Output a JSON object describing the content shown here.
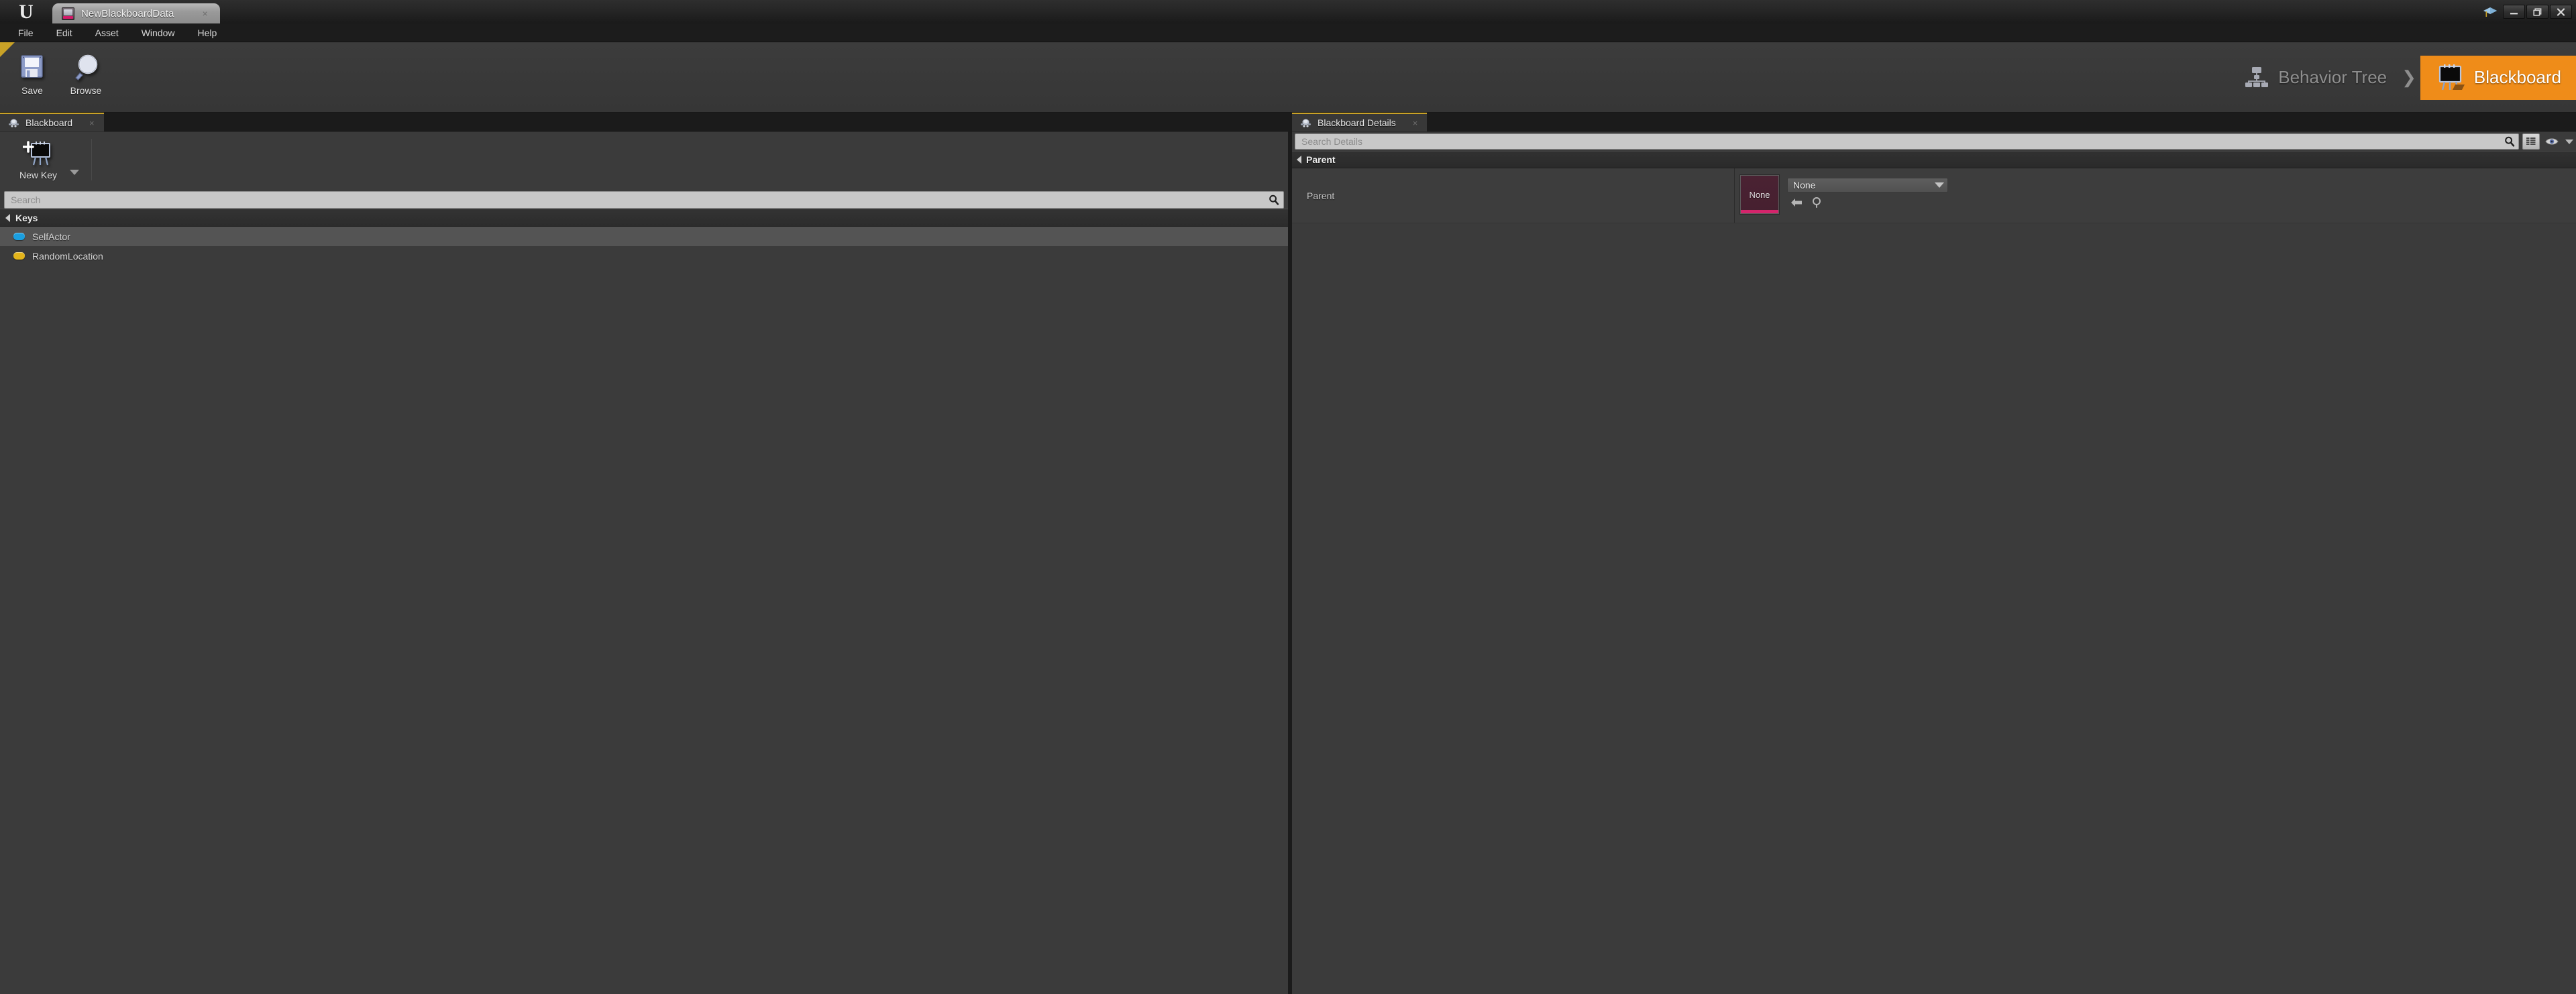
{
  "window": {
    "title": "NewBlackboardData",
    "tab_icon": "blackboard-asset-icon",
    "tab_close": "×",
    "logo": "unreal-engine-logo",
    "grad_icon": "editor-badge-icon",
    "minimize": "minimize-icon",
    "maximize": "restore-icon",
    "close": "close-icon"
  },
  "menubar": {
    "items": [
      {
        "label": "File"
      },
      {
        "label": "Edit"
      },
      {
        "label": "Asset"
      },
      {
        "label": "Window"
      },
      {
        "label": "Help"
      }
    ]
  },
  "toolbar": {
    "buttons": [
      {
        "label": "Save",
        "icon": "floppy-disk-icon"
      },
      {
        "label": "Browse",
        "icon": "magnifier-icon"
      }
    ]
  },
  "mode_switcher": {
    "behavior_tree": {
      "label": "Behavior Tree",
      "icon": "behavior-tree-icon",
      "active": false
    },
    "separator": "❯",
    "blackboard": {
      "label": "Blackboard",
      "icon": "blackboard-icon",
      "active": true
    },
    "active_color": "#ef8c19"
  },
  "blackboard_panel": {
    "tab": {
      "label": "Blackboard",
      "icon": "blackboard-tab-icon",
      "close": "×"
    },
    "new_key": {
      "label": "New Key",
      "icon": "new-key-icon",
      "caret": "chevron-down-icon"
    },
    "search": {
      "value": "",
      "placeholder": "Search",
      "icon": "search-icon"
    },
    "category": {
      "label": "Keys",
      "expanded": true
    },
    "keys": [
      {
        "name": "SelfActor",
        "color": "#1b9fe0",
        "selected": true
      },
      {
        "name": "RandomLocation",
        "color": "#e3b41b",
        "selected": false
      }
    ]
  },
  "details_panel": {
    "tab": {
      "label": "Blackboard Details",
      "icon": "blackboard-tab-icon",
      "close": "×"
    },
    "search": {
      "value": "",
      "placeholder": "Search Details",
      "icon": "search-icon"
    },
    "toolbar_icons": [
      {
        "name": "column-view-icon"
      },
      {
        "name": "visibility-eye-icon"
      },
      {
        "name": "chevron-down-icon"
      }
    ],
    "category": {
      "label": "Parent",
      "expanded": true
    },
    "properties": [
      {
        "name": "Parent",
        "thumbnail_label": "None",
        "thumbnail_color": "#4a2233",
        "thumbnail_accent": "#d4246b",
        "combo_value": "None",
        "combo_caret": "chevron-down-icon",
        "actions": [
          {
            "name": "use-selected-asset-icon"
          },
          {
            "name": "browse-to-asset-icon"
          }
        ]
      }
    ]
  }
}
